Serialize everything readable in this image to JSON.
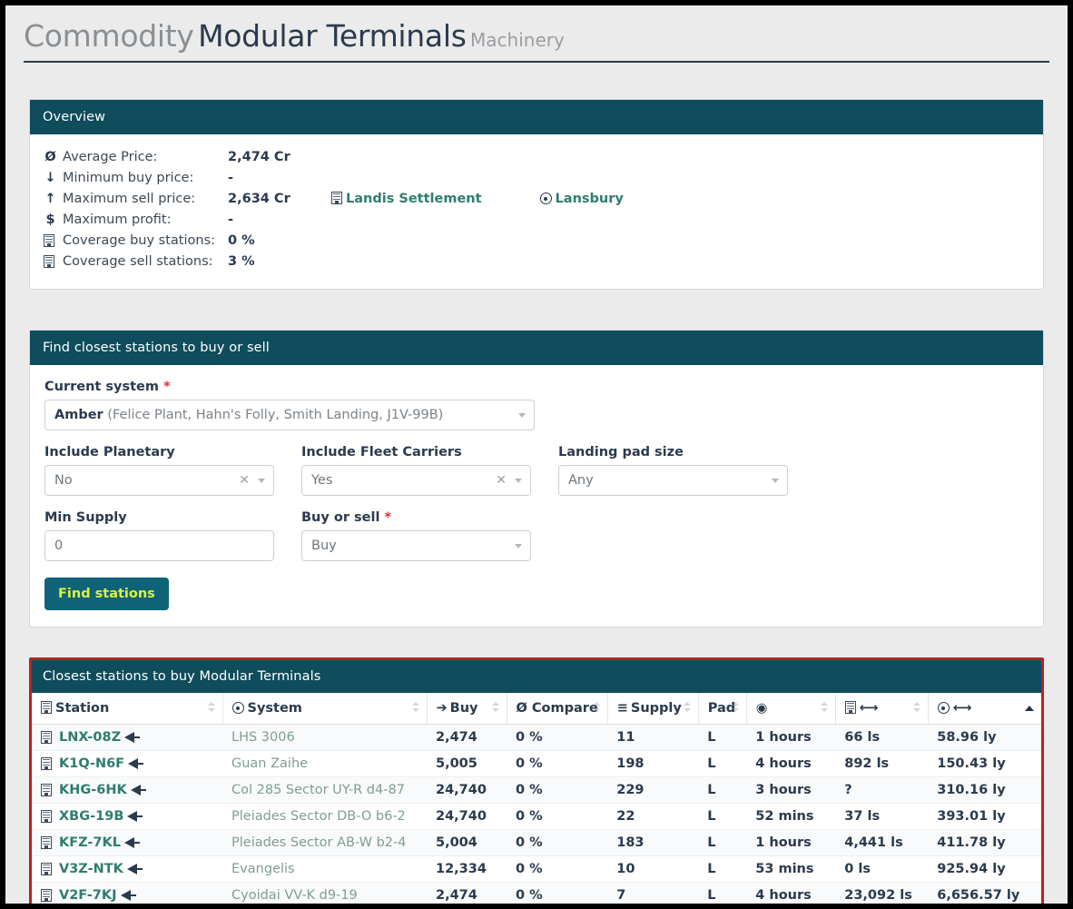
{
  "title": {
    "prefix": "Commodity",
    "name": "Modular Terminals",
    "category": "Machinery"
  },
  "overview": {
    "heading": "Overview",
    "rows": [
      {
        "icon": "average-icon",
        "glyph": "Ø",
        "label": "Average Price:",
        "value": "2,474 Cr"
      },
      {
        "icon": "arrow-down-icon",
        "glyph": "↓",
        "label": "Minimum buy price:",
        "value": "-"
      },
      {
        "icon": "arrow-up-icon",
        "glyph": "↑",
        "label": "Maximum sell price:",
        "value": "2,634 Cr"
      },
      {
        "icon": "dollar-icon",
        "glyph": "$",
        "label": "Maximum profit:",
        "value": "-"
      },
      {
        "icon": "station-icon",
        "glyph": "",
        "label": "Coverage buy stations:",
        "value": "0 %"
      },
      {
        "icon": "station-icon",
        "glyph": "",
        "label": "Coverage sell stations:",
        "value": "3 %"
      }
    ],
    "max_sell_station": "Landis Settlement",
    "max_sell_system": "Lansbury"
  },
  "finder": {
    "heading": "Find closest stations to buy or sell",
    "current_system": {
      "label": "Current system",
      "required": "*",
      "value_strong": "Amber",
      "value_sub": "(Felice Plant, Hahn's Folly, Smith Landing, J1V-99B)"
    },
    "include_planetary": {
      "label": "Include Planetary",
      "value": "No"
    },
    "include_fleet_carriers": {
      "label": "Include Fleet Carriers",
      "value": "Yes"
    },
    "landing_pad_size": {
      "label": "Landing pad size",
      "value": "Any"
    },
    "min_supply": {
      "label": "Min Supply",
      "value": "0"
    },
    "buy_or_sell": {
      "label": "Buy or sell",
      "required": "*",
      "value": "Buy"
    },
    "submit_label": "Find stations"
  },
  "results": {
    "heading": "Closest stations to buy Modular Terminals",
    "columns": [
      {
        "key": "station",
        "label": "Station",
        "icon": "station-icon",
        "sortable": true
      },
      {
        "key": "system",
        "label": "System",
        "icon": "system-icon",
        "sortable": true
      },
      {
        "key": "buy",
        "label": "Buy",
        "icon": "buy-icon",
        "sortable": true
      },
      {
        "key": "compare",
        "label": "Ø Compare",
        "icon": "",
        "sortable": true
      },
      {
        "key": "supply",
        "label": "Supply",
        "icon": "supply-icon",
        "sortable": true
      },
      {
        "key": "pad",
        "label": "Pad",
        "icon": "",
        "sortable": true
      },
      {
        "key": "updated",
        "label": "",
        "icon": "clock-icon",
        "sortable": true
      },
      {
        "key": "station_distance",
        "label": "",
        "icon": "station-distance-icon",
        "sortable": true
      },
      {
        "key": "system_distance",
        "label": "",
        "icon": "system-distance-icon",
        "sortable": true,
        "sorted": "asc"
      }
    ],
    "rows": [
      {
        "station": "LNX-08Z",
        "carrier": true,
        "system": "LHS 3006",
        "buy": "2,474",
        "compare": "0 %",
        "supply": "11",
        "pad": "L",
        "updated": "1 hours",
        "station_distance": "66 ls",
        "system_distance": "58.96 ly"
      },
      {
        "station": "K1Q-N6F",
        "carrier": true,
        "system": "Guan Zaihe",
        "buy": "5,005",
        "compare": "0 %",
        "supply": "198",
        "pad": "L",
        "updated": "4 hours",
        "station_distance": "892 ls",
        "system_distance": "150.43 ly"
      },
      {
        "station": "KHG-6HK",
        "carrier": true,
        "system": "Col 285 Sector UY-R d4-87",
        "buy": "24,740",
        "compare": "0 %",
        "supply": "229",
        "pad": "L",
        "updated": "3 hours",
        "station_distance": "?",
        "system_distance": "310.16 ly"
      },
      {
        "station": "XBG-19B",
        "carrier": true,
        "system": "Pleiades Sector DB-O b6-2",
        "buy": "24,740",
        "compare": "0 %",
        "supply": "22",
        "pad": "L",
        "updated": "52 mins",
        "station_distance": "37 ls",
        "system_distance": "393.01 ly"
      },
      {
        "station": "KFZ-7KL",
        "carrier": true,
        "system": "Pleiades Sector AB-W b2-4",
        "buy": "5,004",
        "compare": "0 %",
        "supply": "183",
        "pad": "L",
        "updated": "1 hours",
        "station_distance": "4,441 ls",
        "system_distance": "411.78 ly"
      },
      {
        "station": "V3Z-NTK",
        "carrier": true,
        "system": "Evangelis",
        "buy": "12,334",
        "compare": "0 %",
        "supply": "10",
        "pad": "L",
        "updated": "53 mins",
        "station_distance": "0 ls",
        "system_distance": "925.94 ly"
      },
      {
        "station": "V2F-7KJ",
        "carrier": true,
        "system": "Cyoidai VV-K d9-19",
        "buy": "2,474",
        "compare": "0 %",
        "supply": "7",
        "pad": "L",
        "updated": "4 hours",
        "station_distance": "23,092 ls",
        "system_distance": "6,656.57 ly"
      }
    ]
  },
  "colors": {
    "panel_header": "#0f4c5c",
    "link": "#2f7d6e",
    "system_link": "#7f9d92",
    "highlight_border": "#b92222",
    "button_bg": "#0f6378",
    "button_text": "#dff23a",
    "required": "#e03030"
  }
}
